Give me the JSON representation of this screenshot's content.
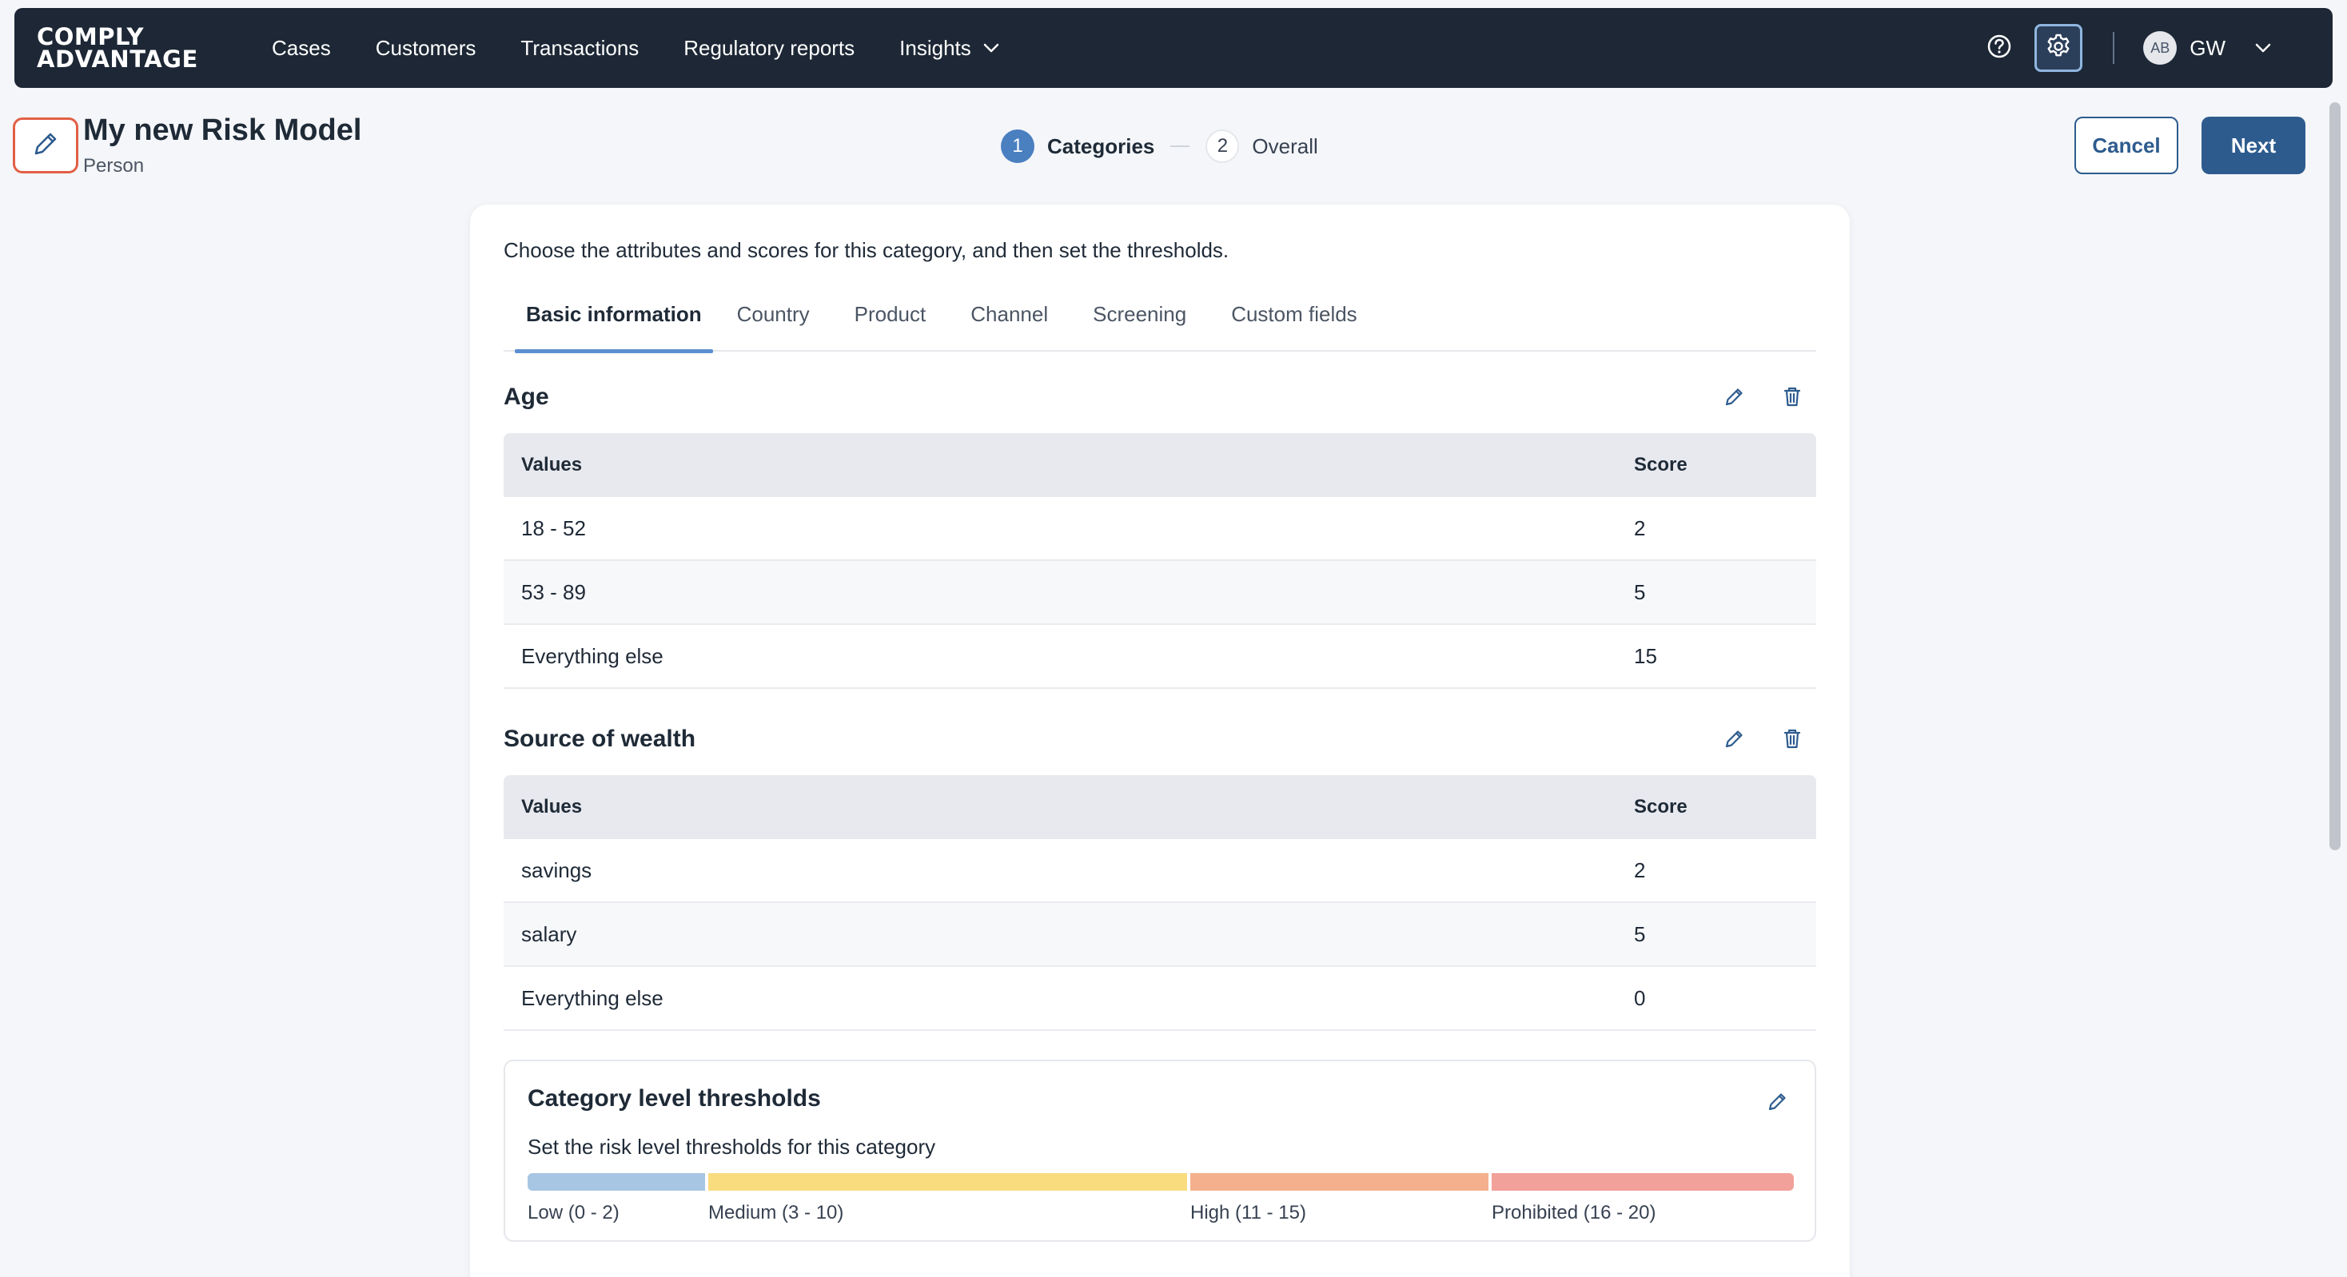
{
  "brand": {
    "line1": "COMPLY",
    "line2": "ADVANTAGE"
  },
  "nav": {
    "items": [
      {
        "label": "Cases"
      },
      {
        "label": "Customers"
      },
      {
        "label": "Transactions"
      },
      {
        "label": "Regulatory reports"
      },
      {
        "label": "Insights",
        "has_dropdown": true
      }
    ],
    "help_icon": "help-circle-icon",
    "settings_icon": "gear-icon",
    "user": {
      "avatar": "AB",
      "initials": "GW"
    }
  },
  "header": {
    "title": "My new Risk Model",
    "subtitle": "Person",
    "steps": [
      {
        "number": "1",
        "label": "Categories",
        "active": true
      },
      {
        "number": "2",
        "label": "Overall",
        "active": false
      }
    ],
    "cancel_label": "Cancel",
    "next_label": "Next"
  },
  "card": {
    "intro": "Choose the attributes and scores for this category, and then set the thresholds.",
    "tabs": [
      {
        "label": "Basic information",
        "active": true
      },
      {
        "label": "Country"
      },
      {
        "label": "Product"
      },
      {
        "label": "Channel"
      },
      {
        "label": "Screening"
      },
      {
        "label": "Custom fields"
      }
    ],
    "sections": [
      {
        "title": "Age",
        "headers": {
          "values": "Values",
          "score": "Score"
        },
        "rows": [
          {
            "value": "18 - 52",
            "score": "2"
          },
          {
            "value": "53 - 89",
            "score": "5"
          },
          {
            "value": "Everything else",
            "score": "15"
          }
        ]
      },
      {
        "title": "Source of wealth",
        "headers": {
          "values": "Values",
          "score": "Score"
        },
        "rows": [
          {
            "value": "savings",
            "score": "2"
          },
          {
            "value": "salary",
            "score": "5"
          },
          {
            "value": "Everything else",
            "score": "0"
          }
        ]
      }
    ],
    "thresholds": {
      "title": "Category level thresholds",
      "subtitle": "Set the risk level thresholds for this category",
      "max": 20,
      "levels": [
        {
          "label": "Low (0 - 2)",
          "from": 0,
          "to": 2,
          "color": "#a7c6e4"
        },
        {
          "label": "Medium (3 - 10)",
          "from": 3,
          "to": 10,
          "color": "#f9dc7e"
        },
        {
          "label": "High (11 - 15)",
          "from": 11,
          "to": 15,
          "color": "#f4b08d"
        },
        {
          "label": "Prohibited (16 - 20)",
          "from": 16,
          "to": 20,
          "color": "#f2a19a"
        }
      ]
    }
  }
}
